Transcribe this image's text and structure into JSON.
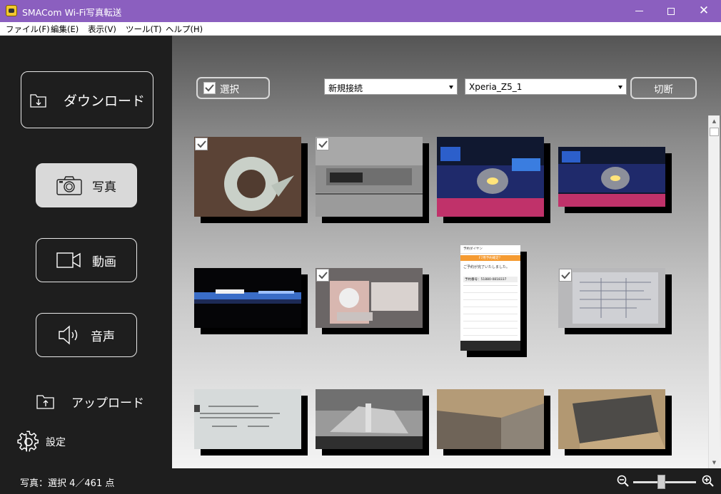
{
  "window": {
    "title": "SMACom Wi-Fi写真転送",
    "close_glyph": "✕"
  },
  "menu": [
    {
      "label": "ファイル(F)"
    },
    {
      "label": "編集(E)"
    },
    {
      "label": "表示(V)"
    },
    {
      "label": "ツール(T)"
    },
    {
      "label": "ヘルプ(H)"
    }
  ],
  "sidebar": {
    "download": "ダウンロード",
    "photo": "写真",
    "video": "動画",
    "audio": "音声",
    "upload": "アップロード",
    "settings": "設定"
  },
  "toolbar": {
    "select_label": "選択",
    "connection_selected": "新規接続",
    "device_selected": "Xperia_Z5_1",
    "disconnect_label": "切断"
  },
  "thumbnails": [
    {
      "subject": "white-ring-on-wood",
      "checked": true
    },
    {
      "subject": "power-adapter-on-rack",
      "checked": true
    },
    {
      "subject": "illuminated-character-statue",
      "checked": false
    },
    {
      "subject": "illuminated-character-statue",
      "checked": false
    },
    {
      "subject": "night-illumination-scene",
      "checked": false
    },
    {
      "subject": "dog-poster-shop-display",
      "checked": true
    },
    {
      "subject": "phone-reservation-screenshot",
      "checked": false
    },
    {
      "subject": "printed-document",
      "checked": true
    },
    {
      "subject": "business-card-document",
      "checked": false
    },
    {
      "subject": "faucet-fixture",
      "checked": false
    },
    {
      "subject": "wooden-cabinet-corner",
      "checked": false
    },
    {
      "subject": "wooden-cabinet-corner",
      "checked": false
    }
  ],
  "phone_screenshot": {
    "header": "予約ダイヤン",
    "banner": "F7用予約確定？",
    "message": "ご予約が完了いたしました。",
    "reservation_label": "予約番号：51880-0818337"
  },
  "status": {
    "text": "写真：選択 4／461 点",
    "zoom_level": 0.45
  }
}
